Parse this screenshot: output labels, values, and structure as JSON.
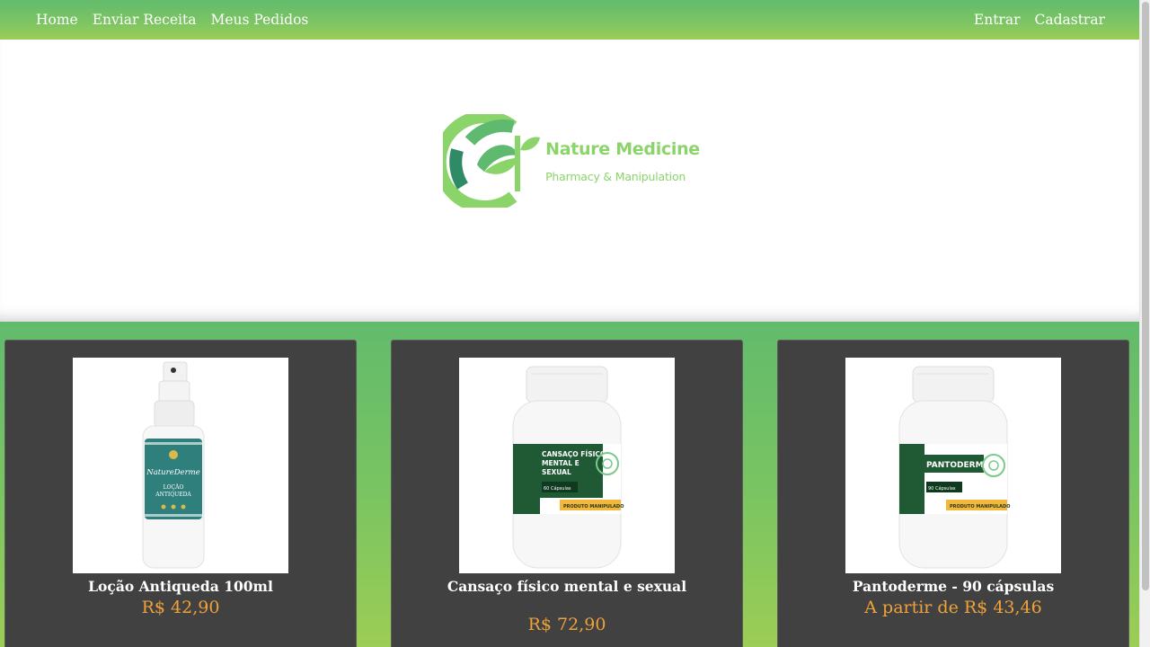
{
  "nav": {
    "left": [
      {
        "label": "Home"
      },
      {
        "label": "Enviar Receita"
      },
      {
        "label": "Meus Pedidos"
      }
    ],
    "right": [
      {
        "label": "Entrar"
      },
      {
        "label": "Cadastrar"
      }
    ]
  },
  "brand": {
    "name": "Nature Medicine",
    "tagline": "Pharmacy & Manipulation",
    "color": "#8bd46a"
  },
  "products": [
    {
      "name": "Loção Antiqueda 100ml",
      "price": "R$ 42,90",
      "image_icon": "spray-bottle-icon",
      "label_lines": [
        "NatureDerme",
        "LOÇÃO",
        "ANTIQUEDA"
      ]
    },
    {
      "name": "Cansaço físico mental e sexual",
      "price": "R$ 72,90",
      "image_icon": "capsule-jar-icon",
      "label_lines": [
        "CANSAÇO FÍSICO",
        "MENTAL E",
        "SEXUAL",
        "60 Cápsulas",
        "PRODUTO MANIPULADO"
      ]
    },
    {
      "name": "Pantoderme - 90 cápsulas",
      "price": "A partir de R$ 43,46",
      "image_icon": "capsule-jar-icon",
      "label_lines": [
        "PANTODERME",
        "90 Cápsulas",
        "PRODUTO MANIPULADO"
      ]
    }
  ],
  "colors": {
    "nav_gradient_top": "#62bb6c",
    "nav_gradient_bottom": "#9ccd55",
    "card_background": "#414141",
    "price": "#f0a23a"
  }
}
